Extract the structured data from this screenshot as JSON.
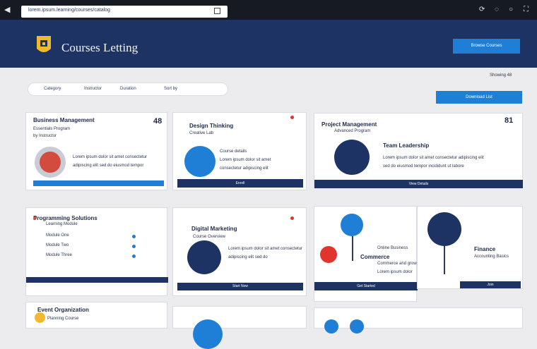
{
  "window": {
    "url_text": "lorem.ipsum.learning/courses/catalog",
    "controls": [
      "⟳",
      "◌",
      "○",
      "⛶"
    ]
  },
  "header": {
    "brand": "Courses Letting",
    "cta_label": "Browse Courses"
  },
  "filters": [
    "Category",
    "Instructor",
    "Duration",
    "Sort by"
  ],
  "meta": {
    "results": "Showing 48",
    "action_label": "Download List"
  },
  "cards": [
    {
      "title": "Business Management",
      "subtitle": "Essentials Program",
      "byline": "by Instructor",
      "num": "48",
      "desc1": "Lorem ipsum dolor sit amet consectetur",
      "desc2": "adipiscing elit sed do eiusmod tempor",
      "footer": ""
    },
    {
      "title": "Design Thinking",
      "subtitle": "Creative Lab",
      "byline": "Course details",
      "num": "",
      "desc1": "Lorem ipsum dolor sit amet",
      "desc2": "consectetur adipiscing elit",
      "footer": "Enroll"
    },
    {
      "title": "Project Management",
      "subtitle": "Advanced Program",
      "byline": "Team Leadership",
      "num": "81",
      "desc1": "Lorem ipsum dolor sit amet consectetur adipiscing elit",
      "desc2": "sed do eiusmod tempor incididunt ut labore",
      "footer": "View Details"
    },
    {
      "title": "Programming Solutions",
      "subtitle": "Learning Module",
      "byline": "",
      "num": "",
      "items": [
        "Module One",
        "Module Two",
        "Module Three"
      ],
      "desc1": "",
      "desc2": "",
      "footer": ""
    },
    {
      "title": "Digital Marketing",
      "subtitle": "Course Overview",
      "byline": "",
      "num": "",
      "desc1": "Lorem ipsum dolor sit amet consectetur",
      "desc2": "adipiscing elit sed do",
      "footer": "Start Now"
    },
    {
      "title": "Commerce",
      "subtitle": "Online Business",
      "byline": "",
      "num": "",
      "desc1": "Commerce and growth",
      "desc2": "Lorem ipsum dolor",
      "footer": "Get Started"
    },
    {
      "title": "Finance",
      "subtitle": "Accounting Basics",
      "byline": "",
      "num": "",
      "desc1": "",
      "desc2": "",
      "footer": "Join"
    },
    {
      "title": "Event Organization",
      "subtitle": "Planning Course",
      "byline": "",
      "num": "",
      "desc1": "",
      "desc2": "",
      "footer": ""
    }
  ]
}
